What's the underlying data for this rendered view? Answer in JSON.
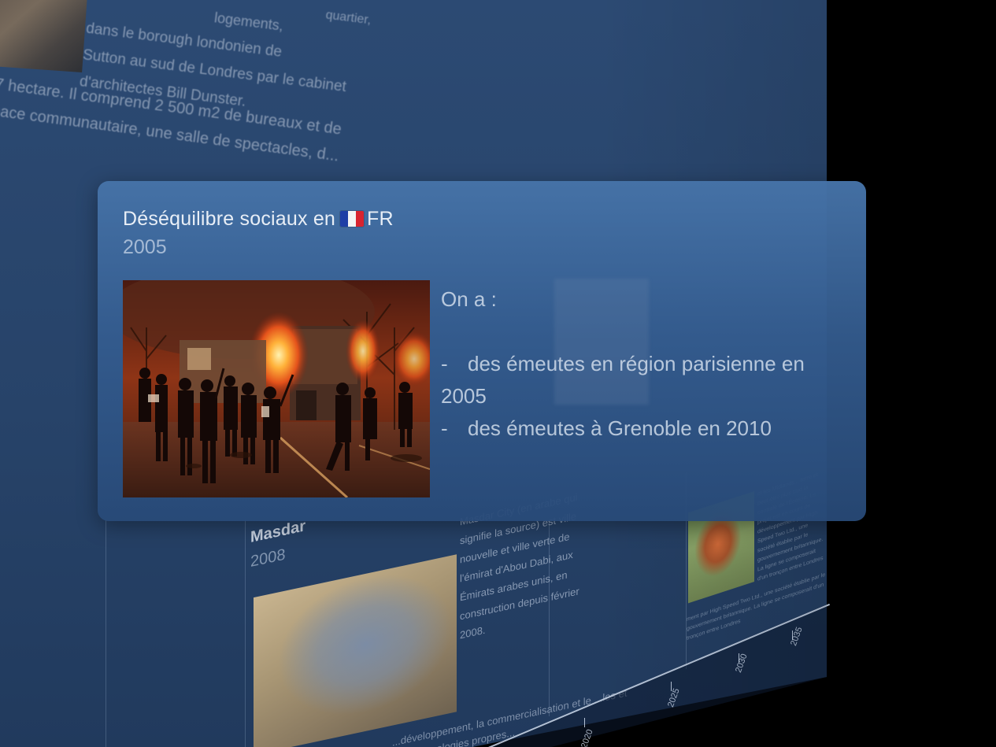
{
  "background": {
    "top_text_lines": [
      "quartier,",
      "logements,",
      "dans le borough londonien de",
      "Sutton au sud de Londres par le cabinet",
      "d'architectes Bill Dunster.",
      "7 hectare. Il comprend 2 500 m2 de bureaux et de",
      "pace communautaire, une salle de spectacles, d..."
    ]
  },
  "main_card": {
    "title": "Déséquilibre sociaux en",
    "country": "FR",
    "year": "2005",
    "photo_icon": "riot-photo",
    "body": {
      "intro": "On a :",
      "items": [
        "des émeutes en région parisienne en 2005",
        "des émeutes à Grenoble en 2010"
      ]
    }
  },
  "masdar_card": {
    "title": "Masdar",
    "year": "2008",
    "description": "Masdar City (en arabe qui signifie la source) est ville nouvelle et ville verte de l'émirat d'Abou Dabi, aux Émirats arabes unis, en construction depuis février 2008.",
    "footer": "...développement, la commercialisation et le ...les et des technologies propres..."
  },
  "train_card": {
    "text_right": "et les Midlands... terre et peut-être plus tard la centrale de l'Écosse. Le projet est en cours de développement par High Speed Two Ltd., une société établie par le gouvernement britannique. La ligne se composerait d'un tronçon entre Londres",
    "footer": "ment par High Speed Two Ltd., une société établie par le gouvernement britannique. La ligne se composerait d'un tronçon entre Londres"
  },
  "axis": {
    "ticks": [
      "2020",
      "2025",
      "2030",
      "2035"
    ]
  },
  "colors": {
    "card_top": "#4673a8",
    "card_bottom": "#284a78",
    "wall": "#2a466d",
    "axis": "#dce8fa"
  }
}
